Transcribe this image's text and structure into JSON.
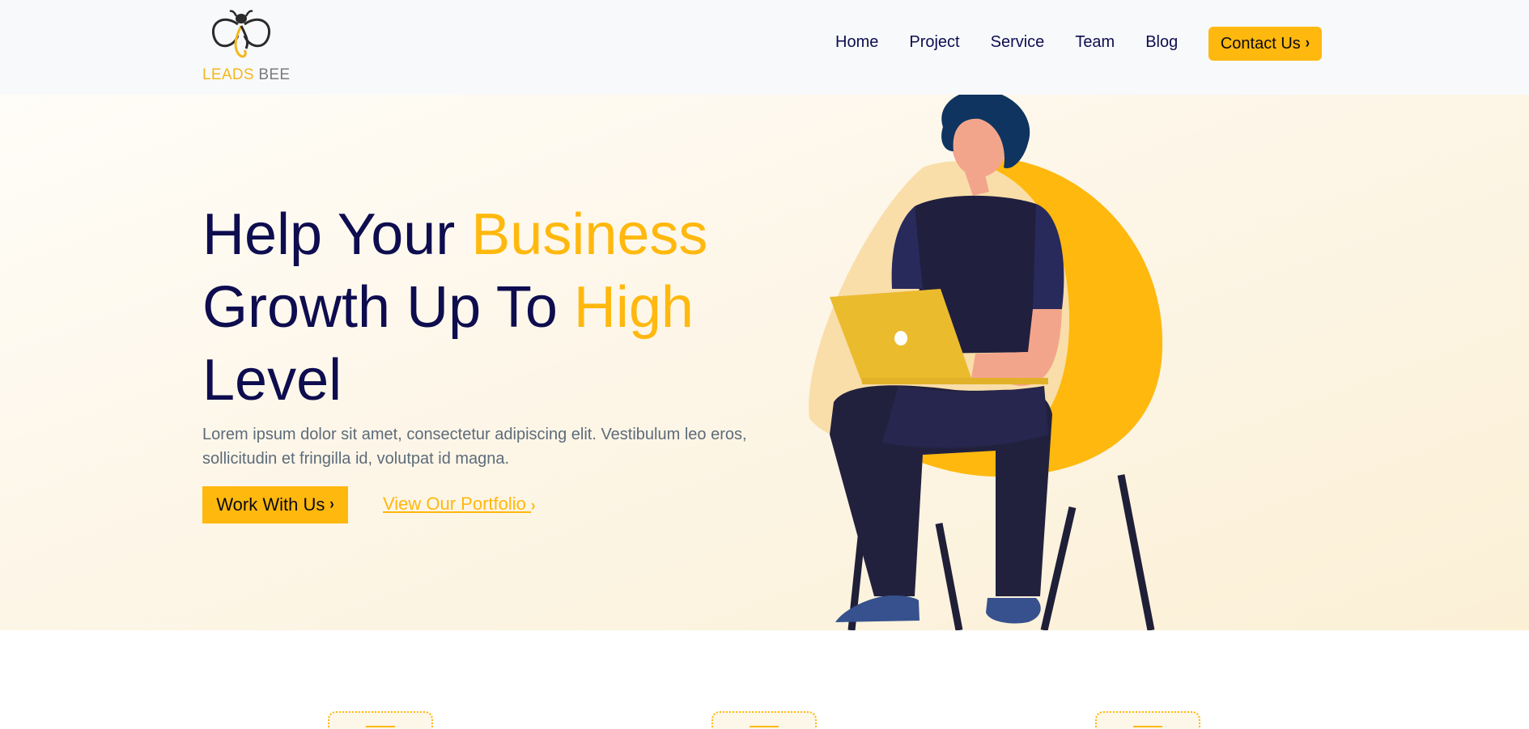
{
  "brand": {
    "name_part1": "LEADS",
    "name_part2": "BEE"
  },
  "nav": {
    "links": [
      "Home",
      "Project",
      "Service",
      "Team",
      "Blog"
    ],
    "contact_label": "Contact Us"
  },
  "hero": {
    "title_l1a": "Help Your ",
    "title_l1b": "Business",
    "title_l2a": "Growth Up To ",
    "title_l2b": "High",
    "title_l3": "Level",
    "description": "Lorem ipsum dolor sit amet, consectetur adipiscing elit. Vestibulum leo eros, sollicitudin et fringilla id, volutpat id magna.",
    "primary_button": "Work With Us",
    "secondary_link": "View Our Portfolio "
  },
  "colors": {
    "accent": "#ffb80e",
    "navy": "#0e0d4f",
    "text_muted": "#5d6b7a"
  },
  "icons": [
    "bee-logo-icon",
    "chevron-right-icon",
    "person-laptop-illustration"
  ]
}
